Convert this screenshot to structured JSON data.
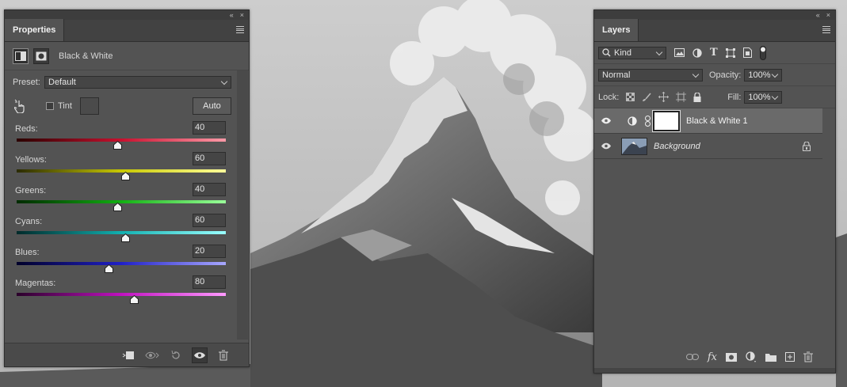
{
  "properties": {
    "tab_label": "Properties",
    "adjustment_name": "Black & White",
    "preset_label": "Preset:",
    "preset_value": "Default",
    "tint_label": "Tint",
    "auto_label": "Auto",
    "sliders": [
      {
        "label": "Reds:",
        "value": "40",
        "fraction": 0.48,
        "colors": [
          "#2a0000",
          "#c8102e",
          "#ff9aa8"
        ]
      },
      {
        "label": "Yellows:",
        "value": "60",
        "fraction": 0.52,
        "colors": [
          "#2a2a00",
          "#c8c800",
          "#ffff9a"
        ]
      },
      {
        "label": "Greens:",
        "value": "40",
        "fraction": 0.48,
        "colors": [
          "#002a00",
          "#12b012",
          "#9aff9a"
        ]
      },
      {
        "label": "Cyans:",
        "value": "60",
        "fraction": 0.52,
        "colors": [
          "#002a2a",
          "#12b0b0",
          "#9affff"
        ]
      },
      {
        "label": "Blues:",
        "value": "20",
        "fraction": 0.44,
        "colors": [
          "#00002a",
          "#2020c8",
          "#a8a8ff"
        ]
      },
      {
        "label": "Magentas:",
        "value": "80",
        "fraction": 0.56,
        "colors": [
          "#2a002a",
          "#c012c0",
          "#ff9aff"
        ]
      }
    ]
  },
  "layers": {
    "tab_label": "Layers",
    "filter_kind": "Kind",
    "blend_mode": "Normal",
    "opacity_label": "Opacity:",
    "opacity_value": "100%",
    "lock_label": "Lock:",
    "fill_label": "Fill:",
    "fill_value": "100%",
    "items": [
      {
        "name": "Black & White 1",
        "selected": true
      },
      {
        "name": "Background",
        "selected": false
      }
    ]
  },
  "icons": {
    "collapse": "«",
    "close": "×",
    "fx": "fx",
    "text_tool": "T"
  }
}
